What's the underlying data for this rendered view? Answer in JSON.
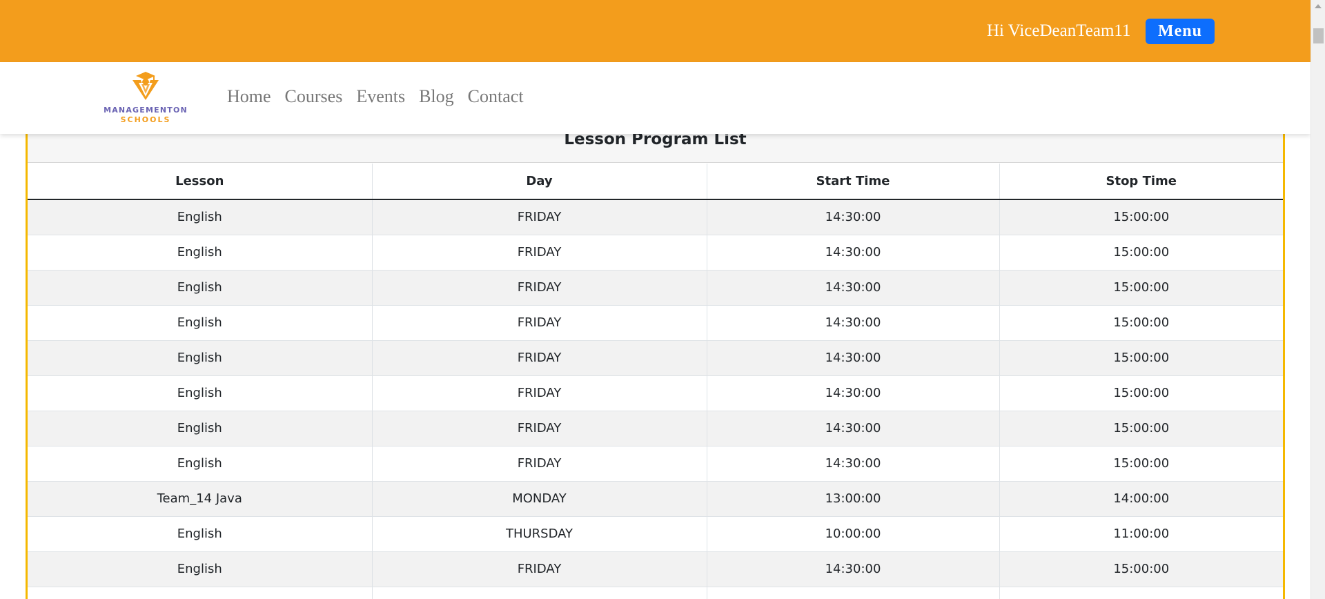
{
  "topbar": {
    "greeting": "Hi ViceDeanTeam11",
    "menu_label": "Menu",
    "background_color": "#f39d1c",
    "menu_button_color": "#0d6efd"
  },
  "logo": {
    "line1": "MANAGEMENTON",
    "line2": "SCHOOLS"
  },
  "nav": {
    "items": [
      {
        "label": "Home"
      },
      {
        "label": "Courses"
      },
      {
        "label": "Events"
      },
      {
        "label": "Blog"
      },
      {
        "label": "Contact"
      }
    ]
  },
  "lesson_program": {
    "title": "Lesson Program List",
    "columns": [
      "Lesson",
      "Day",
      "Start Time",
      "Stop Time"
    ],
    "rows": [
      [
        "English",
        "FRIDAY",
        "14:30:00",
        "15:00:00"
      ],
      [
        "English",
        "FRIDAY",
        "14:30:00",
        "15:00:00"
      ],
      [
        "English",
        "FRIDAY",
        "14:30:00",
        "15:00:00"
      ],
      [
        "English",
        "FRIDAY",
        "14:30:00",
        "15:00:00"
      ],
      [
        "English",
        "FRIDAY",
        "14:30:00",
        "15:00:00"
      ],
      [
        "English",
        "FRIDAY",
        "14:30:00",
        "15:00:00"
      ],
      [
        "English",
        "FRIDAY",
        "14:30:00",
        "15:00:00"
      ],
      [
        "English",
        "FRIDAY",
        "14:30:00",
        "15:00:00"
      ],
      [
        "Team_14 Java",
        "MONDAY",
        "13:00:00",
        "14:00:00"
      ],
      [
        "English",
        "THURSDAY",
        "10:00:00",
        "11:00:00"
      ],
      [
        "English",
        "FRIDAY",
        "14:30:00",
        "15:00:00"
      ],
      [
        "",
        "",
        "",
        ""
      ]
    ]
  },
  "colors": {
    "card_border": "#f5b800",
    "logo_purple": "#6a63b3",
    "logo_orange": "#f39d1c"
  }
}
